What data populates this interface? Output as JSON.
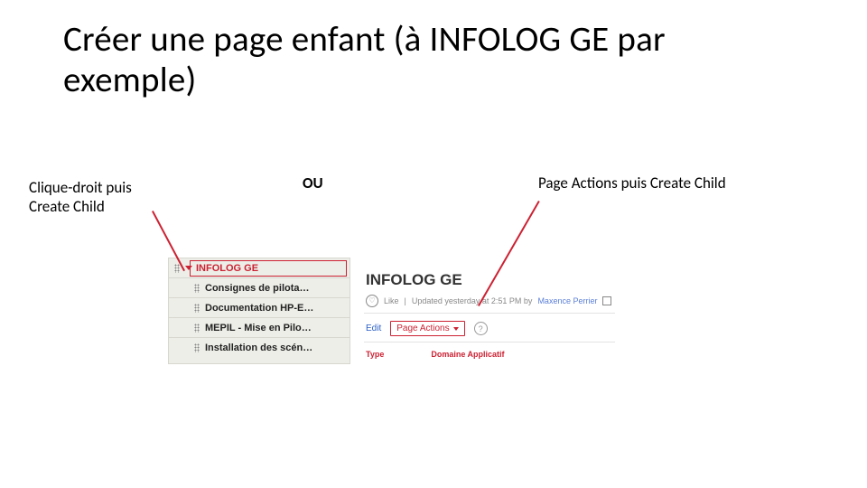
{
  "title": "Créer une page enfant (à INFOLOG GE par exemple)",
  "captions": {
    "left": "Clique-droit puis Create Child",
    "mid": "OU",
    "right": "Page Actions puis Create Child"
  },
  "tree": {
    "root": "INFOLOG GE",
    "items": [
      "Consignes de pilota…",
      "Documentation HP-E…",
      "MEPIL - Mise en Pilo…",
      "Installation des scén…"
    ]
  },
  "page": {
    "title": "INFOLOG GE",
    "likes": "Like",
    "meta": "Updated yesterday at 2:51 PM by",
    "author": "Maxence Perrier",
    "edit": "Edit",
    "actions": "Page Actions",
    "footerLeft": "Type",
    "footerRight": "Domaine Applicatif"
  }
}
